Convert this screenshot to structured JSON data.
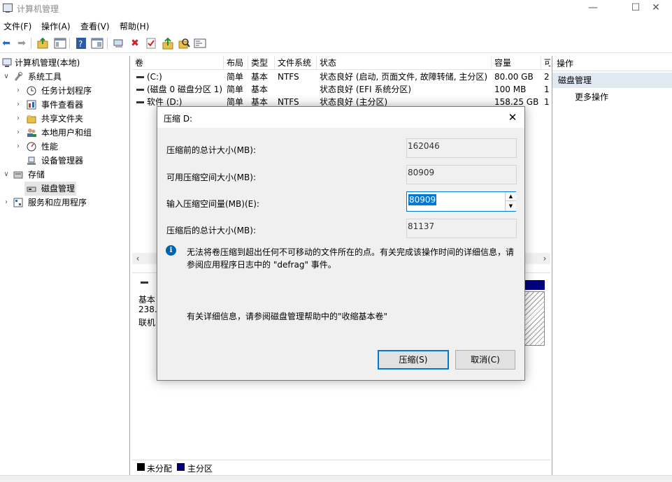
{
  "window": {
    "title": "计算机管理",
    "min_glyph": "—",
    "max_glyph": "☐",
    "close_glyph": "✕"
  },
  "menu": [
    "文件(F)",
    "操作(A)",
    "查看(V)",
    "帮助(H)"
  ],
  "toolbar": {
    "icons": [
      "back-arrow-icon",
      "forward-arrow-icon",
      "up-folder-icon",
      "show-hide-tree-icon",
      "help-icon",
      "properties-icon",
      "connect-icon",
      "delete-icon",
      "check-icon",
      "up-arrow-icon",
      "search-icon",
      "console-icon"
    ]
  },
  "tree": {
    "root": "计算机管理(本地)",
    "system_tools": "系统工具",
    "task_scheduler": "任务计划程序",
    "event_viewer": "事件查看器",
    "shared_folders": "共享文件夹",
    "local_users": "本地用户和组",
    "performance": "性能",
    "device_manager": "设备管理器",
    "storage": "存储",
    "disk_management": "磁盘管理",
    "services": "服务和应用程序"
  },
  "list": {
    "columns": [
      "卷",
      "布局",
      "类型",
      "文件系统",
      "状态",
      "容量",
      "可"
    ],
    "rows": [
      {
        "volume": "(C:)",
        "layout": "简单",
        "type": "基本",
        "fs": "NTFS",
        "status": "状态良好 (启动, 页面文件, 故障转储, 主分区)",
        "capacity": "80.00 GB",
        "free": "2"
      },
      {
        "volume": "(磁盘 0 磁盘分区 1)",
        "layout": "简单",
        "type": "基本",
        "fs": "",
        "status": "状态良好 (EFI 系统分区)",
        "capacity": "100 MB",
        "free": "1"
      },
      {
        "volume": "软件 (D:)",
        "layout": "简单",
        "type": "基本",
        "fs": "NTFS",
        "status": "状态良好 (主分区)",
        "capacity": "158.25 GB",
        "free": "1"
      }
    ]
  },
  "graph": {
    "disk_type": "基本",
    "disk_size": "238.",
    "disk_status": "联机"
  },
  "legend": {
    "unallocated": "未分配",
    "primary": "主分区",
    "unallocated_color": "#000000",
    "primary_color": "#00007f"
  },
  "actions": {
    "header": "操作",
    "selected": "磁盘管理",
    "more": "更多操作"
  },
  "dialog": {
    "title": "压缩 D:",
    "total_before_label": "压缩前的总计大小(MB):",
    "total_before_value": "162046",
    "available_label": "可用压缩空间大小(MB):",
    "available_value": "80909",
    "input_label": "输入压缩空间量(MB)(E):",
    "input_value": "80909",
    "total_after_label": "压缩后的总计大小(MB):",
    "total_after_value": "81137",
    "info_text_1": "无法将卷压缩到超出任何不可移动的文件所在的点。有关完成该操作时间的详细信息，请",
    "info_text_2": "参阅应用程序日志中的 \"defrag\" 事件。",
    "help_text": "有关详细信息，请参阅磁盘管理帮助中的\"收缩基本卷\"",
    "shrink_button": "压缩(S)",
    "cancel_button": "取消(C)",
    "accent_color": "#0078d7"
  }
}
